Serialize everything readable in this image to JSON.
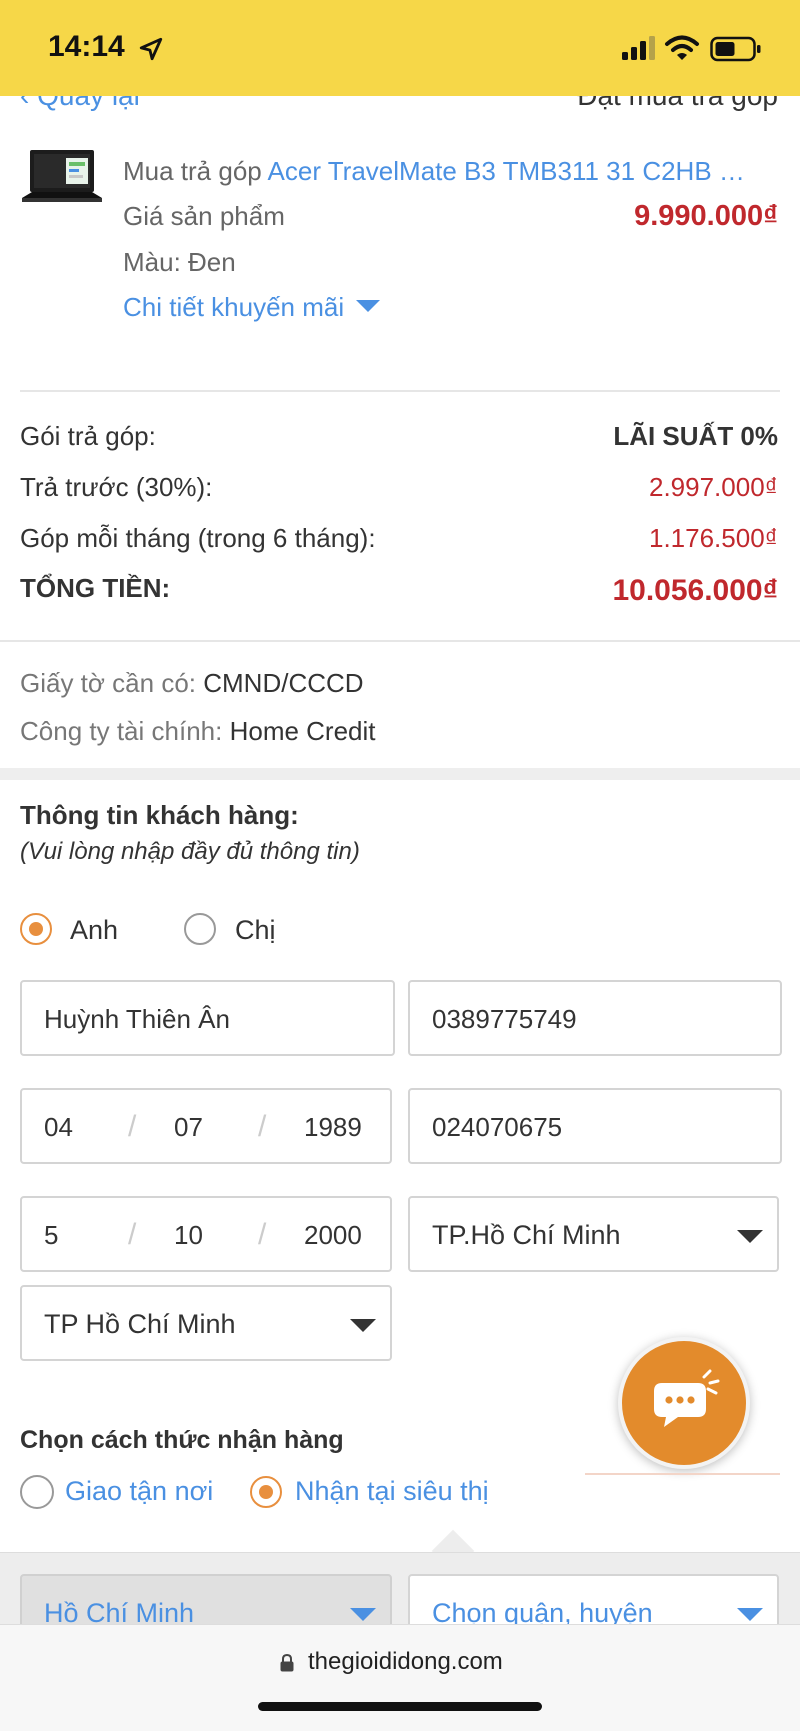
{
  "status_bar": {
    "time": "14:14",
    "icons": [
      "location-arrow-icon",
      "signal-icon",
      "wifi-icon",
      "battery-icon"
    ]
  },
  "header": {
    "back_label": "Quay lại",
    "title": "Đặt mua trả góp"
  },
  "product": {
    "name_prefix": "Mua trả góp",
    "name_link": "Acer TravelMate B3 TMB311 31 C2HB …",
    "price_label": "Giá sản phẩm",
    "price": "9.990.000₫",
    "color_label": "Màu: Đen",
    "promo_link": "Chi tiết khuyến mãi"
  },
  "installment": {
    "package_label": "Gói trả góp:",
    "package_value": "LÃI SUẤT 0%",
    "prepay_label": "Trả trước (30%):",
    "prepay_value": "2.997.000₫",
    "monthly_label": "Góp mỗi tháng (trong 6 tháng):",
    "monthly_value": "1.176.500₫",
    "total_label": "TỔNG TIỀN:",
    "total_value": "10.056.000₫"
  },
  "docs": {
    "docs_label": "Giấy tờ cần có:",
    "docs_value": "CMND/CCCD",
    "finance_label": "Công ty tài chính:",
    "finance_value": "Home Credit"
  },
  "customer": {
    "title": "Thông tin khách hàng:",
    "note": "(Vui lòng nhập đầy đủ thông tin)",
    "gender_options": [
      "Anh",
      "Chị"
    ],
    "gender_selected": "Anh",
    "full_name": "Huỳnh Thiên Ân",
    "phone": "0389775749",
    "birth_day": "04",
    "birth_month": "07",
    "birth_year": "1989",
    "id_number": "024070675",
    "issue_day": "5",
    "issue_month": "10",
    "issue_year": "2000",
    "issue_place": "TP.Hồ Chí Minh",
    "city": "TP Hồ Chí Minh",
    "date_separator": "/"
  },
  "delivery": {
    "title": "Chọn cách thức nhận hàng",
    "option_home": "Giao tận nơi",
    "option_store": "Nhận tại siêu thị",
    "selected": "Nhận tại siêu thị",
    "store_city": "Hồ Chí Minh",
    "store_district_placeholder": "Chọn quận, huyện"
  },
  "browser": {
    "url": "thegioididong.com"
  },
  "colors": {
    "status_bar": "#f6d748",
    "link": "#4a90e2",
    "price_red": "#c0282d",
    "radio_orange": "#e88f3e",
    "chat_orange": "#e38b2c"
  }
}
